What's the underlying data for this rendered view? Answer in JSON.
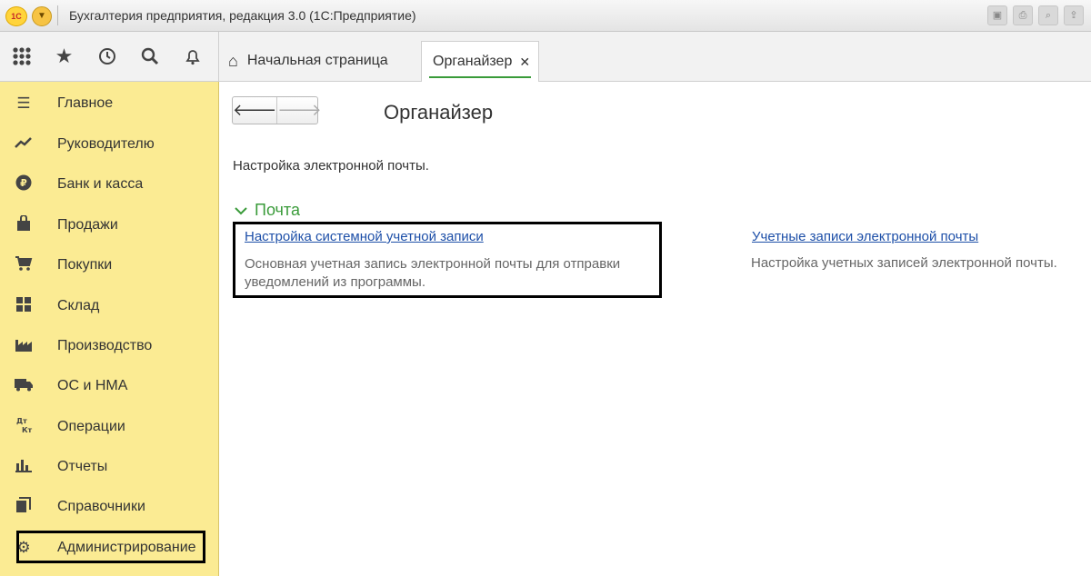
{
  "window": {
    "logo_text": "1С",
    "title": "Бухгалтерия предприятия, редакция 3.0  (1С:Предприятие)"
  },
  "toolbar_icons": [
    "apps-grid-icon",
    "star-icon",
    "history-icon",
    "search-icon",
    "bell-icon"
  ],
  "tabs": {
    "home_label": "Начальная страница",
    "active_label": "Органайзер",
    "close_glyph": "✕"
  },
  "sidebar": {
    "items": [
      {
        "label": "Главное",
        "icon": "menu-icon"
      },
      {
        "label": "Руководителю",
        "icon": "trend-icon"
      },
      {
        "label": "Банк и касса",
        "icon": "ruble-icon"
      },
      {
        "label": "Продажи",
        "icon": "bag-icon"
      },
      {
        "label": "Покупки",
        "icon": "cart-icon"
      },
      {
        "label": "Склад",
        "icon": "warehouse-icon"
      },
      {
        "label": "Производство",
        "icon": "factory-icon"
      },
      {
        "label": "ОС и НМА",
        "icon": "truck-icon"
      },
      {
        "label": "Операции",
        "icon": "dt-kt-icon"
      },
      {
        "label": "Отчеты",
        "icon": "bar-chart-icon"
      },
      {
        "label": "Справочники",
        "icon": "books-icon"
      },
      {
        "label": "Администрирование",
        "icon": "gear-icon"
      }
    ],
    "highlighted": "Администрирование"
  },
  "main": {
    "title": "Органайзер",
    "description": "Настройка электронной почты.",
    "group_title": "Почта",
    "link1": {
      "label": "Настройка системной учетной записи",
      "text": "Основная учетная запись электронной почты для отправки уведомлений из программы."
    },
    "link2": {
      "label": "Учетные записи электронной почты",
      "text": "Настройка учетных записей электронной почты."
    }
  },
  "colors": {
    "sidebar_bg": "#fbeb93",
    "group_green": "#3a9b3a",
    "link_blue": "#1d4fa8"
  }
}
